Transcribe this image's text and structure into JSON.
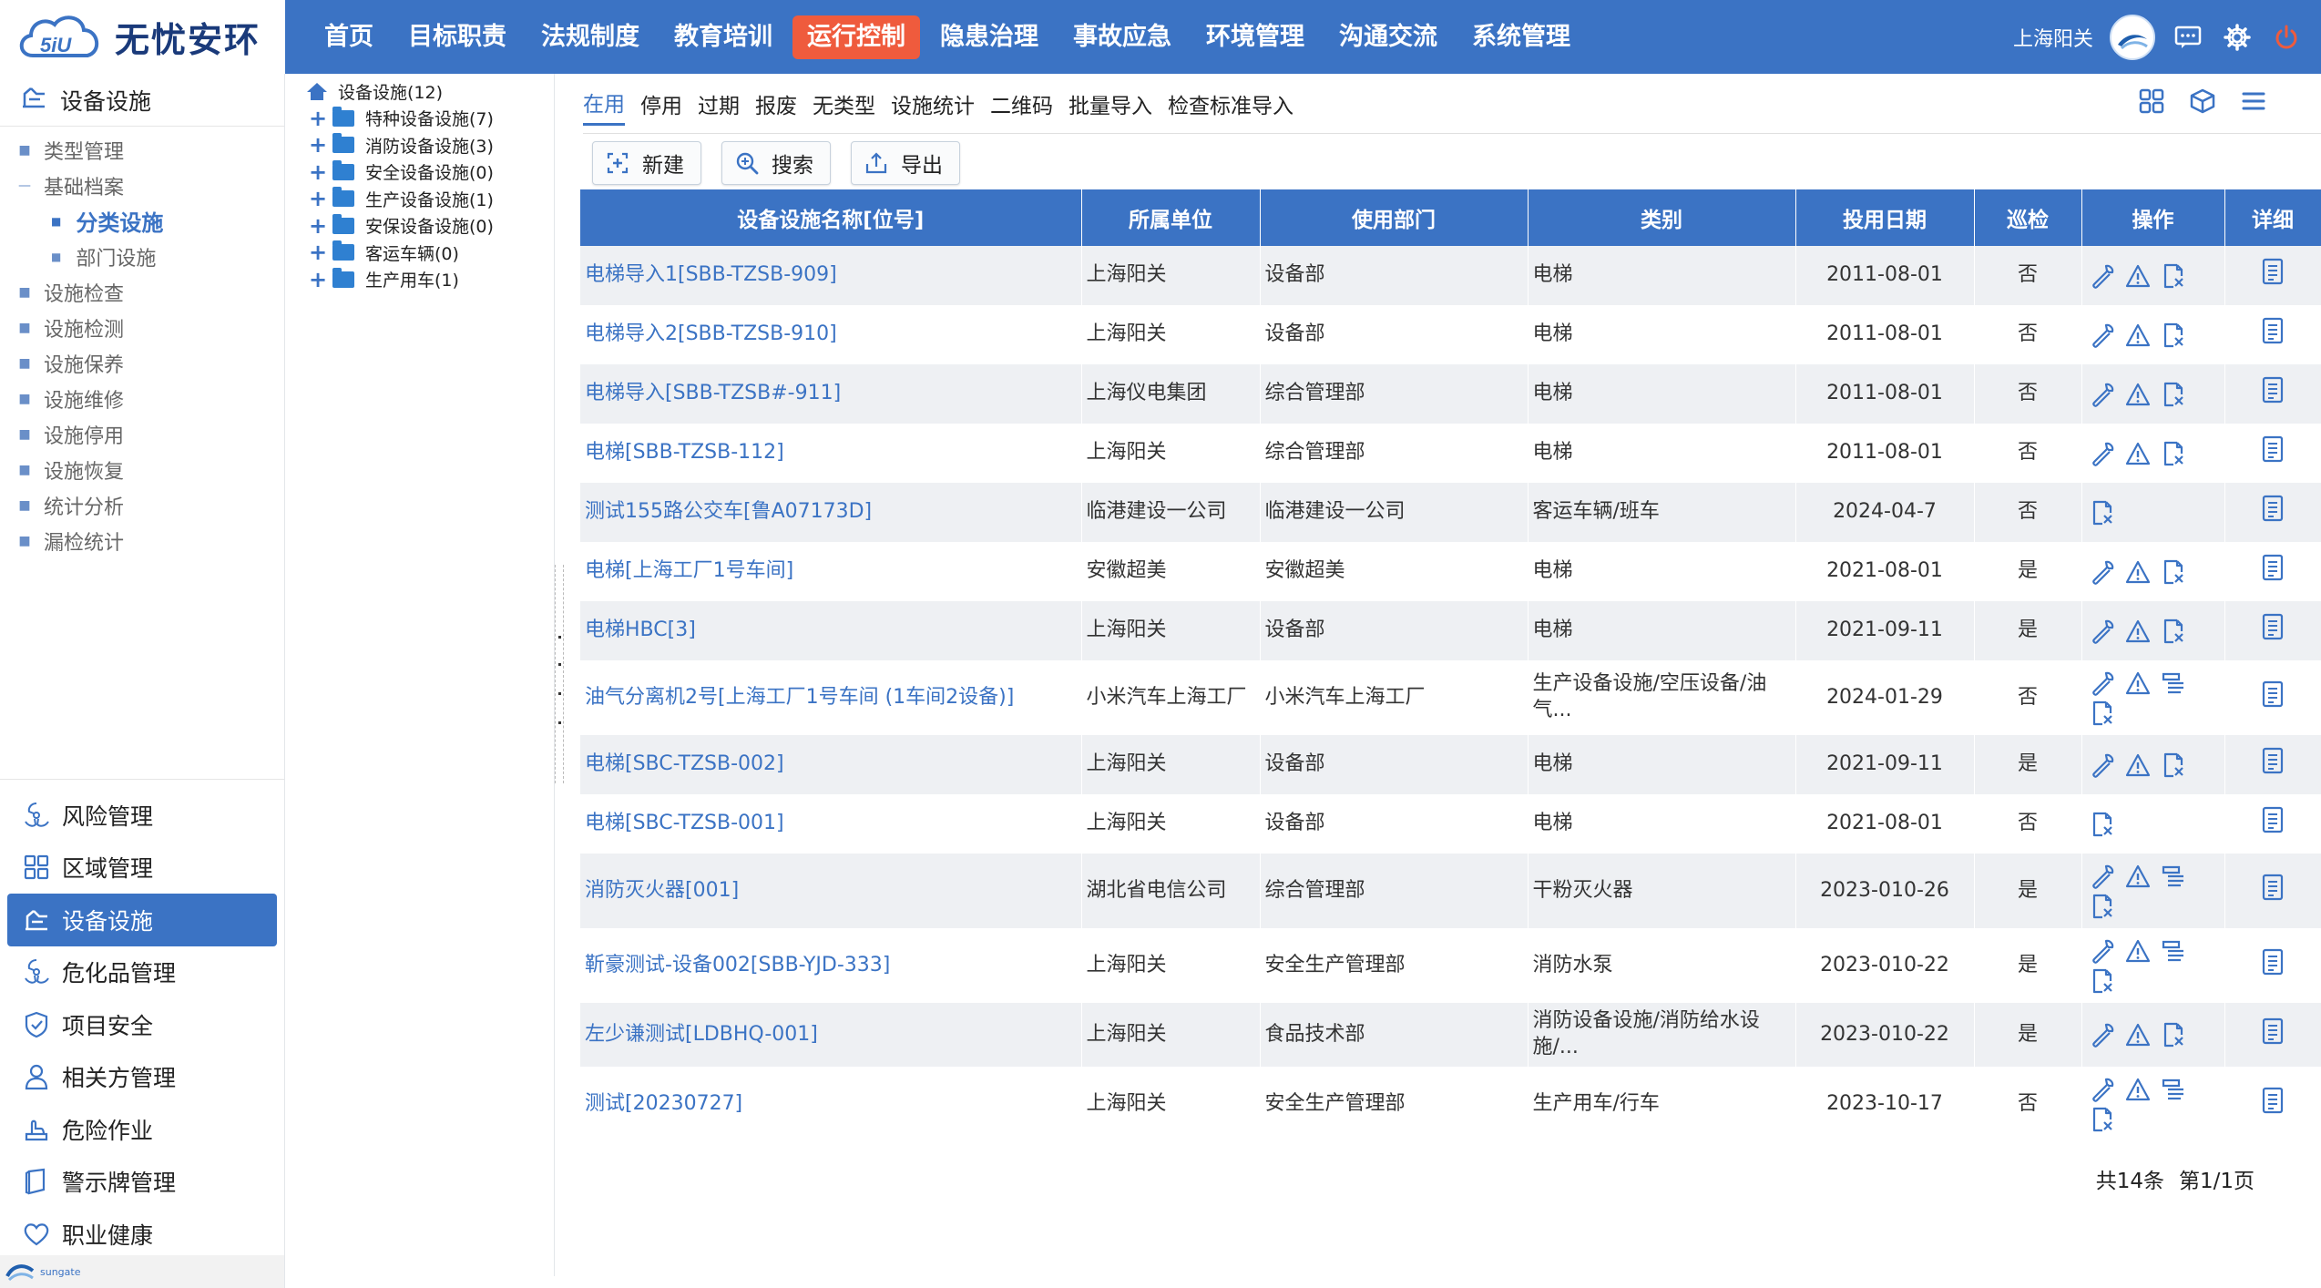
{
  "app": {
    "logo_text": "无忧安环",
    "logo_mark_text": "5iU",
    "footer_brand": "sungate"
  },
  "nav": [
    "首页",
    "目标职责",
    "法规制度",
    "教育培训",
    "运行控制",
    "隐患治理",
    "事故应急",
    "环境管理",
    "沟通交流",
    "系统管理"
  ],
  "nav_active": 4,
  "user": {
    "name": "上海阳关"
  },
  "sidebar": {
    "title": "设备设施",
    "items": [
      {
        "label": "类型管理",
        "mark": "■"
      },
      {
        "label": "基础档案",
        "mark": "—"
      }
    ],
    "children": [
      {
        "label": "分类设施",
        "active": true
      },
      {
        "label": "部门设施",
        "active": false
      }
    ],
    "items2": [
      {
        "label": "设施检查"
      },
      {
        "label": "设施检测"
      },
      {
        "label": "设施保养"
      },
      {
        "label": "设施维修"
      },
      {
        "label": "设施停用"
      },
      {
        "label": "设施恢复"
      },
      {
        "label": "统计分析"
      },
      {
        "label": "漏检统计"
      }
    ],
    "modules": [
      {
        "label": "风险管理",
        "icon": "radiation-icon"
      },
      {
        "label": "区域管理",
        "icon": "grid-icon"
      },
      {
        "label": "设备设施",
        "icon": "equipment-icon",
        "active": true
      },
      {
        "label": "危化品管理",
        "icon": "hazard-icon"
      },
      {
        "label": "项目安全",
        "icon": "shield-icon"
      },
      {
        "label": "相关方管理",
        "icon": "person-icon"
      },
      {
        "label": "危险作业",
        "icon": "hand-icon"
      },
      {
        "label": "警示牌管理",
        "icon": "sign-icon"
      },
      {
        "label": "职业健康",
        "icon": "heart-icon"
      }
    ]
  },
  "tree": {
    "root": "设备设施(12)",
    "nodes": [
      "特种设备设施(7)",
      "消防设备设施(3)",
      "安全设备设施(0)",
      "生产设备设施(1)",
      "安保设备设施(0)",
      "客运车辆(0)",
      "生产用车(1)"
    ]
  },
  "tabs": [
    "在用",
    "停用",
    "过期",
    "报废",
    "无类型",
    "设施统计",
    "二维码",
    "批量导入",
    "检查标准导入"
  ],
  "toolbar": {
    "new": "新建",
    "search": "搜索",
    "export": "导出"
  },
  "table": {
    "headers": [
      "设备设施名称[位号]",
      "所属单位",
      "使用部门",
      "类别",
      "投用日期",
      "巡检",
      "操作",
      "详细"
    ],
    "rows": [
      {
        "name": "电梯导入1[SBB-TZSB-909]",
        "unit": "上海阳关",
        "dept": "设备部",
        "cat": "电梯",
        "date": "2011-08-01",
        "patrol": "否",
        "ops": [
          "wrench",
          "warning",
          "doc"
        ]
      },
      {
        "name": "电梯导入2[SBB-TZSB-910]",
        "unit": "上海阳关",
        "dept": "设备部",
        "cat": "电梯",
        "date": "2011-08-01",
        "patrol": "否",
        "ops": [
          "wrench",
          "warning",
          "doc"
        ]
      },
      {
        "name": "电梯导入[SBB-TZSB#-911]",
        "unit": "上海仪电集团",
        "dept": "综合管理部",
        "cat": "电梯",
        "date": "2011-08-01",
        "patrol": "否",
        "ops": [
          "wrench",
          "warning",
          "doc"
        ]
      },
      {
        "name": "电梯[SBB-TZSB-112]",
        "unit": "上海阳关",
        "dept": "综合管理部",
        "cat": "电梯",
        "date": "2011-08-01",
        "patrol": "否",
        "ops": [
          "wrench",
          "warning",
          "doc"
        ]
      },
      {
        "name": "测试155路公交车[鲁A07173D]",
        "unit": "临港建设一公司",
        "dept": "临港建设一公司",
        "cat": "客运车辆/班车",
        "date": "2024-04-7",
        "patrol": "否",
        "ops": [
          "doc"
        ]
      },
      {
        "name": "电梯[上海工厂1号车间]",
        "unit": "安徽超美",
        "dept": "安徽超美",
        "cat": "电梯",
        "date": "2021-08-01",
        "patrol": "是",
        "ops": [
          "wrench",
          "warning",
          "doc"
        ]
      },
      {
        "name": "电梯HBC[3]",
        "unit": "上海阳关",
        "dept": "设备部",
        "cat": "电梯",
        "date": "2021-09-11",
        "patrol": "是",
        "ops": [
          "wrench",
          "warning",
          "doc"
        ]
      },
      {
        "name": "油气分离机2号[上海工厂1号车间 (1车间2设备)]",
        "unit": "小米汽车上海工厂",
        "dept": "小米汽车上海工厂",
        "cat": "生产设备设施/空压设备/油气...",
        "date": "2024-01-29",
        "patrol": "否",
        "ops": [
          "wrench",
          "warning",
          "list",
          "doc"
        ]
      },
      {
        "name": "电梯[SBC-TZSB-002]",
        "unit": "上海阳关",
        "dept": "设备部",
        "cat": "电梯",
        "date": "2021-09-11",
        "patrol": "是",
        "ops": [
          "wrench",
          "warning",
          "doc"
        ]
      },
      {
        "name": "电梯[SBC-TZSB-001]",
        "unit": "上海阳关",
        "dept": "设备部",
        "cat": "电梯",
        "date": "2021-08-01",
        "patrol": "否",
        "ops": [
          "doc"
        ]
      },
      {
        "name": "消防灭火器[001]",
        "unit": "湖北省电信公司",
        "dept": "综合管理部",
        "cat": "干粉灭火器",
        "date": "2023-010-26",
        "patrol": "是",
        "ops": [
          "wrench",
          "warning",
          "list",
          "doc"
        ]
      },
      {
        "name": "靳豪测试-设备002[SBB-YJD-333]",
        "unit": "上海阳关",
        "dept": "安全生产管理部",
        "cat": "消防水泵",
        "date": "2023-010-22",
        "patrol": "是",
        "ops": [
          "wrench",
          "warning",
          "list",
          "doc"
        ]
      },
      {
        "name": "左少谦测试[LDBHQ-001]",
        "unit": "上海阳关",
        "dept": "食品技术部",
        "cat": "消防设备设施/消防给水设施/...",
        "date": "2023-010-22",
        "patrol": "是",
        "ops": [
          "wrench",
          "warning",
          "doc"
        ]
      },
      {
        "name": "测试[20230727]",
        "unit": "上海阳关",
        "dept": "安全生产管理部",
        "cat": "生产用车/行车",
        "date": "2023-10-17",
        "patrol": "否",
        "ops": [
          "wrench",
          "warning",
          "list",
          "doc"
        ]
      }
    ]
  },
  "pager": {
    "total": "共14条",
    "page": "第1/1页"
  },
  "colors": {
    "primary": "#3b73c4",
    "accent": "#ef5b3d",
    "stripe": "#eef0f3"
  }
}
